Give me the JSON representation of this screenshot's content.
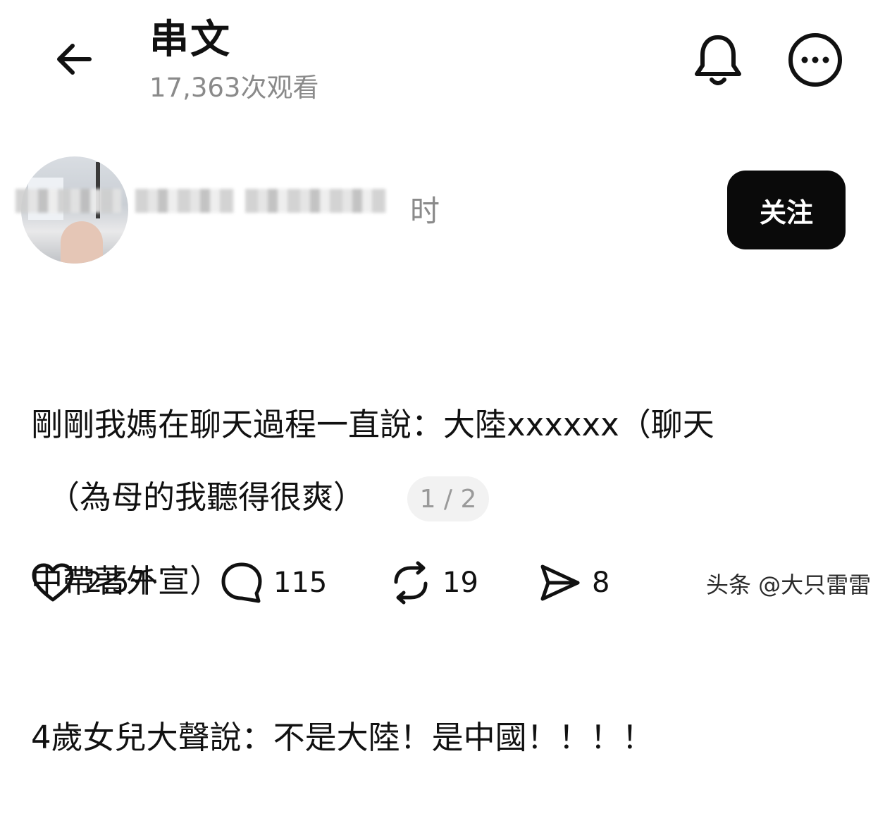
{
  "header": {
    "title": "串文",
    "views": "17,363次观看"
  },
  "user": {
    "time_suffix": "时",
    "follow_label": "关注"
  },
  "post": {
    "lines": [
      "剛剛我媽在聊天過程一直說：大陸xxxxxx（聊天",
      "中帶著外宣）",
      "4歲女兒大聲說：不是大陸！是中國！！！！"
    ],
    "note": "（為母的我聽得很爽）",
    "page_indicator": "1 / 2"
  },
  "actions": {
    "likes": "2.5千",
    "comments": "115",
    "reposts": "19",
    "shares": "8"
  },
  "watermark": "头条 @大只雷雷",
  "icons": {
    "back": "arrow-left-icon",
    "bell": "bell-icon",
    "more": "more-horizontal-icon",
    "like": "heart-icon",
    "comment": "comment-icon",
    "repost": "repost-icon",
    "share": "send-icon"
  }
}
